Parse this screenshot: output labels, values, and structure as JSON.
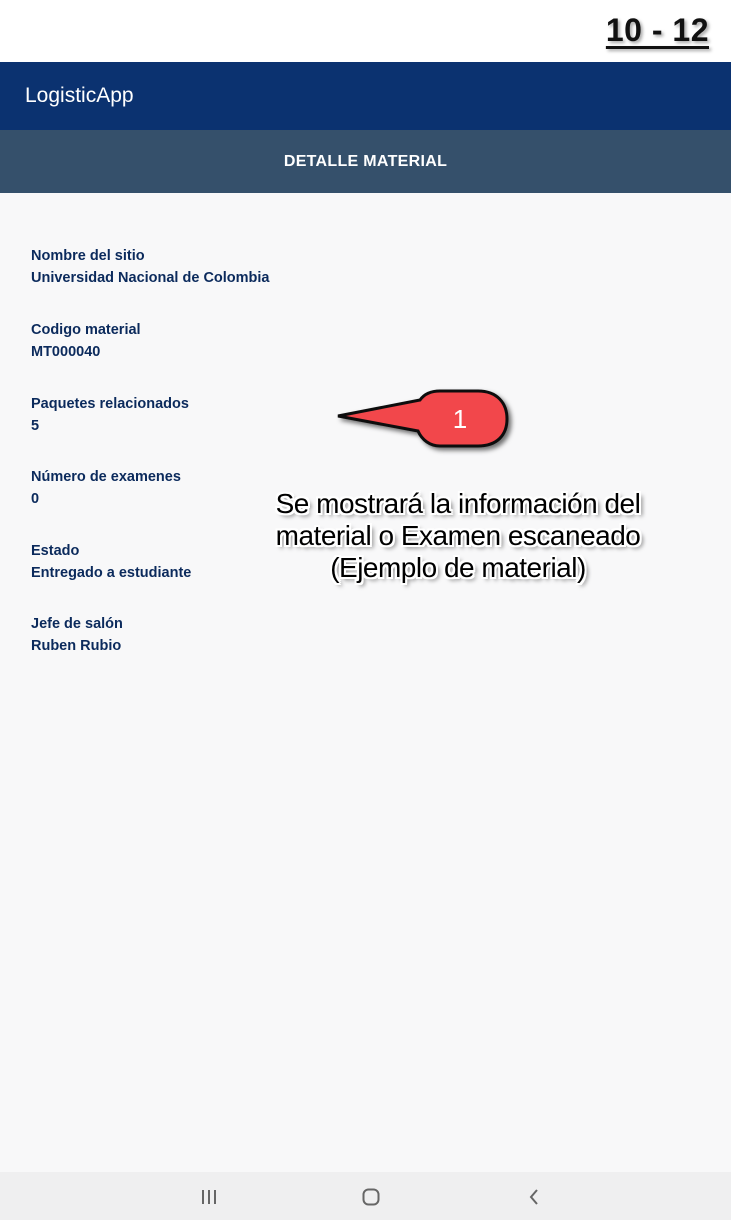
{
  "page_number": "10 - 12",
  "app": {
    "title": "LogisticApp"
  },
  "section": {
    "title": "DETALLE MATERIAL"
  },
  "fields": [
    {
      "label": "Nombre del sitio",
      "value": "Universidad Nacional de Colombia"
    },
    {
      "label": "Codigo material",
      "value": "MT000040"
    },
    {
      "label": "Paquetes relacionados",
      "value": "5"
    },
    {
      "label": "Número de examenes",
      "value": "0"
    },
    {
      "label": "Estado",
      "value": "Entregado a estudiante"
    },
    {
      "label": "Jefe de salón",
      "value": "Ruben Rubio"
    }
  ],
  "callout": {
    "number": "1",
    "color": "#f2474c"
  },
  "annotation": {
    "line1": "Se mostrará la información del",
    "line2": "material o Examen escaneado",
    "line3": "(Ejemplo de material)"
  },
  "nav": {
    "icons": [
      "recent-apps-icon",
      "home-icon",
      "back-icon"
    ]
  },
  "colors": {
    "app_bar": "#0b3270",
    "section_bar": "#35506b",
    "text": "#0b2a5c",
    "background": "#f8f8f9"
  }
}
